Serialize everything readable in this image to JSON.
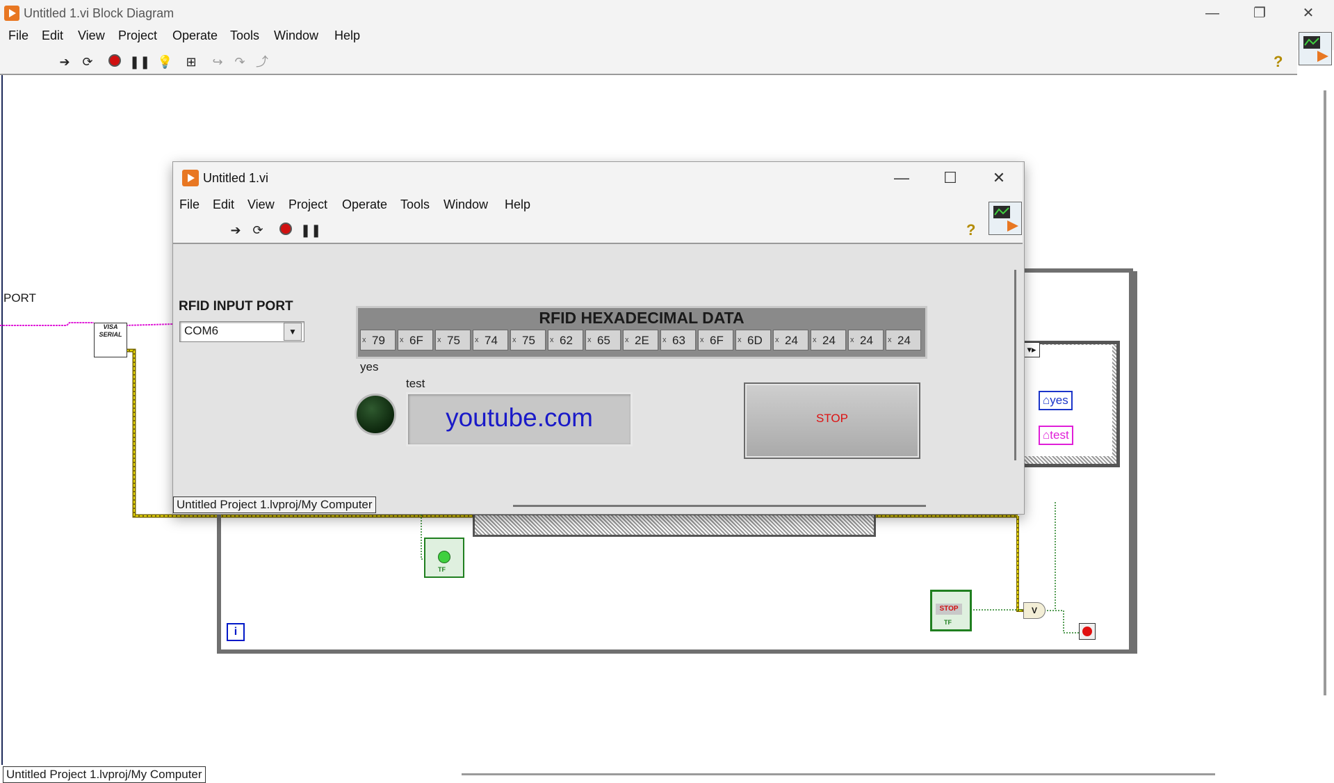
{
  "main_window": {
    "title": "Untitled 1.vi Block Diagram",
    "controls": {
      "minimize": "—",
      "restore": "❐",
      "close": "✕"
    },
    "menu": [
      "File",
      "Edit",
      "View",
      "Project",
      "Operate",
      "Tools",
      "Window",
      "Help"
    ],
    "status": "Untitled Project 1.lvproj/My Computer"
  },
  "diagram": {
    "port_label": "PORT",
    "visa_node_label": "VISA SERIAL",
    "iteration_terminal": "i",
    "case_selector": "▾▸",
    "local_var_yes": "yes",
    "local_var_test": "test",
    "stop_terminal_label": "STOP",
    "terminal_tf": "TF",
    "or_gate": "V"
  },
  "front_panel": {
    "title": "Untitled 1.vi",
    "controls": {
      "minimize": "—",
      "maximize": "☐",
      "close": "✕"
    },
    "menu": [
      "File",
      "Edit",
      "View",
      "Project",
      "Operate",
      "Tools",
      "Window",
      "Help"
    ],
    "status": "Untitled Project 1.lvproj/My Computer",
    "rfid_port_label": "RFID INPUT PORT",
    "rfid_port_value": "COM6",
    "array_title": "RFID HEXADECIMAL DATA",
    "hex_values": [
      "79",
      "6F",
      "75",
      "74",
      "75",
      "62",
      "65",
      "2E",
      "63",
      "6F",
      "6D",
      "24",
      "24",
      "24",
      "24"
    ],
    "radix": "x",
    "yes_label": "yes",
    "test_label": "test",
    "test_value": "youtube.com",
    "stop_label": "STOP"
  },
  "icons": {
    "run": "run-arrow-icon",
    "run_continuous": "run-continuously-icon",
    "abort": "abort-icon",
    "pause": "pause-icon",
    "highlight": "highlight-execution-icon",
    "help": "context-help-icon"
  },
  "colors": {
    "string_wire": "#e01ed8",
    "visa_wire": "#c8b400",
    "bool_wire": "#1f7f1f",
    "led_off": "#0d270d",
    "stop_text": "#dd1111"
  }
}
